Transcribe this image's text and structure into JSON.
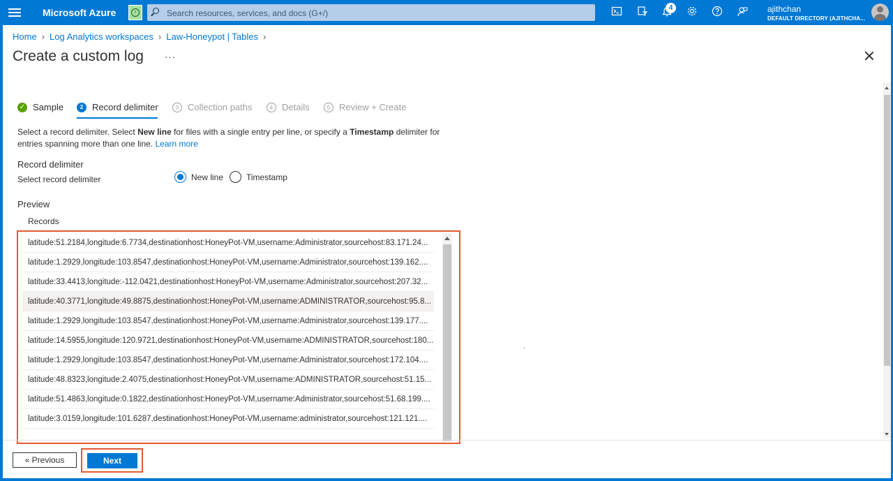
{
  "topbar": {
    "brand": "Microsoft Azure",
    "search_placeholder": "Search resources, services, and docs (G+/)",
    "notifications_count": "4",
    "user_name": "ajithchan",
    "user_directory": "DEFAULT DIRECTORY (AJITHCHA...",
    "icons": [
      "cloud-shell-icon",
      "directory-filter-icon",
      "notifications-icon",
      "settings-icon",
      "help-icon",
      "feedback-icon"
    ]
  },
  "breadcrumb": [
    "Home",
    "Log Analytics workspaces",
    "Law-Honeypot | Tables"
  ],
  "page": {
    "title": "Create a custom log",
    "more": "···"
  },
  "wizard": {
    "tabs": [
      {
        "label": "Sample",
        "state": "done",
        "marker": "✓"
      },
      {
        "label": "Record delimiter",
        "state": "active",
        "marker": "2"
      },
      {
        "label": "Collection paths",
        "state": "inactive",
        "marker": "3"
      },
      {
        "label": "Details",
        "state": "inactive",
        "marker": "4"
      },
      {
        "label": "Review + Create",
        "state": "inactive",
        "marker": "5"
      }
    ]
  },
  "description": {
    "part1": "Select a record delimiter. Select ",
    "newline_bold": "New line",
    "part2": " for files with a single entry per line, or specify a ",
    "timestamp_bold": "Timestamp",
    "part3": " delimiter for entries spanning more than one line. ",
    "learn_more": "Learn more"
  },
  "record_delimiter": {
    "heading": "Record delimiter",
    "label": "Select record delimiter",
    "options": [
      "New line",
      "Timestamp"
    ],
    "selected": "New line"
  },
  "preview": {
    "heading": "Preview",
    "column": "Records",
    "rows": [
      "latitude:51.2184,longitude:6.7734,destinationhost:HoneyPot-VM,username:Administrator,sourcehost:83.171.24...",
      "latitude:1.2929,longitude:103.8547,destinationhost:HoneyPot-VM,username:Administrator,sourcehost:139.162....",
      "latitude:33.4413,longitude:-112.0421,destinationhost:HoneyPot-VM,username:Administrator,sourcehost:207.32...",
      "latitude:40.3771,longitude:49.8875,destinationhost:HoneyPot-VM,username:ADMINISTRATOR,sourcehost:95.8...",
      "latitude:1.2929,longitude:103.8547,destinationhost:HoneyPot-VM,username:Administrator,sourcehost:139.177....",
      "latitude:14.5955,longitude:120.9721,destinationhost:HoneyPot-VM,username:ADMINISTRATOR,sourcehost:180...",
      "latitude:1.2929,longitude:103.8547,destinationhost:HoneyPot-VM,username:Administrator,sourcehost:172.104....",
      "latitude:48.8323,longitude:2.4075,destinationhost:HoneyPot-VM,username:ADMINISTRATOR,sourcehost:51.15...",
      "latitude:51.4863,longitude:0.1822,destinationhost:HoneyPot-VM,username:Administrator,sourcehost:51.68.199....",
      "latitude:3.0159,longitude:101.6287,destinationhost:HoneyPot-VM,username:administrator,sourcehost:121.121...."
    ]
  },
  "footer": {
    "previous": "« Previous",
    "next": "Next"
  },
  "colors": {
    "accent": "#0078d4",
    "highlight_outline": "#e35a32",
    "success": "#57a300"
  }
}
